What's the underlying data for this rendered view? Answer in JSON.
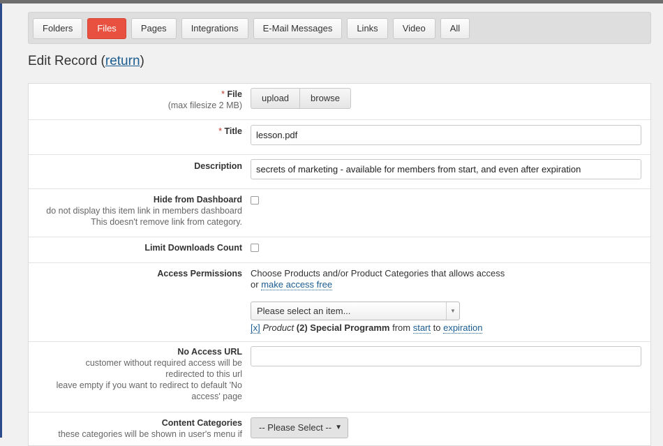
{
  "tabs": [
    {
      "label": "Folders",
      "active": false
    },
    {
      "label": "Files",
      "active": true
    },
    {
      "label": "Pages",
      "active": false
    },
    {
      "label": "Integrations",
      "active": false
    },
    {
      "label": "E-Mail Messages",
      "active": false
    },
    {
      "label": "Links",
      "active": false
    },
    {
      "label": "Video",
      "active": false
    },
    {
      "label": "All",
      "active": false
    }
  ],
  "heading": {
    "text": "Edit Record (",
    "link": "return",
    "close": ")"
  },
  "form": {
    "file": {
      "required": "*",
      "label": "File",
      "help": "(max filesize 2 MB)",
      "upload_label": "upload",
      "browse_label": "browse"
    },
    "title": {
      "required": "*",
      "label": "Title",
      "value": "lesson.pdf"
    },
    "description": {
      "label": "Description",
      "value": "secrets of marketing - available for members from start, and even after expiration"
    },
    "hide": {
      "label": "Hide from Dashboard",
      "help1": "do not display this item link in members dashboard",
      "help2": "This doesn't remove link from category."
    },
    "limit": {
      "label": "Limit Downloads Count"
    },
    "access": {
      "label": "Access Permissions",
      "line1": "Choose Products and/or Product Categories that allows access",
      "or_text": "or",
      "free_link": "make access free",
      "select_placeholder": "Please select an item...",
      "item": {
        "remove": "[x]",
        "type": "Product",
        "name": "(2) Special Programm",
        "from_text": "from",
        "start": "start",
        "to_text": "to",
        "end": "expiration"
      }
    },
    "no_access": {
      "label": "No Access URL",
      "help1": "customer without required access will be",
      "help2": "redirected to this url",
      "help3": "leave empty if you want to redirect to default 'No",
      "help4": "access' page",
      "value": ""
    },
    "categories": {
      "label": "Content Categories",
      "help": "these categories will be shown in user's menu if",
      "select_label": "-- Please Select --"
    }
  }
}
